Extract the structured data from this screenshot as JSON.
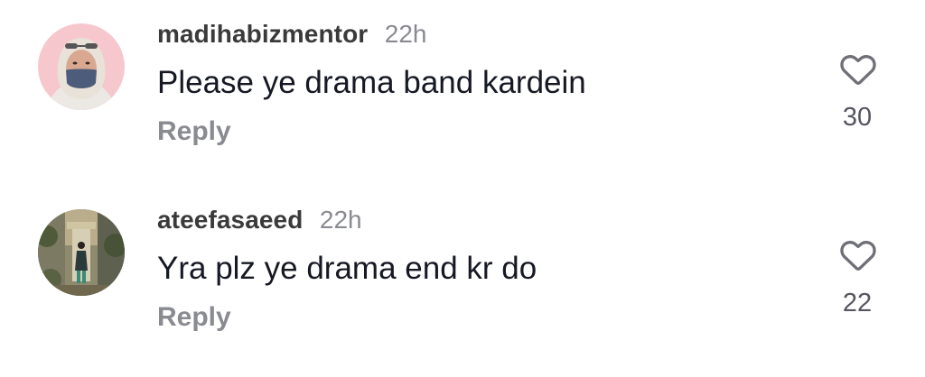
{
  "comments": [
    {
      "username": "madihabizmentor",
      "time": "22h",
      "text": "Please ye drama band kardein",
      "reply_label": "Reply",
      "like_count": "30",
      "like_icon": "heart-outline-icon"
    },
    {
      "username": "ateefasaeed",
      "time": "22h",
      "text": "Yra plz ye drama end kr do",
      "reply_label": "Reply",
      "like_count": "22",
      "like_icon": "heart-outline-icon"
    }
  ],
  "colors": {
    "username": "#3a3a3a",
    "secondary": "#8a8b91",
    "text": "#161823",
    "avatar1_bg": "#f7c9cf"
  }
}
